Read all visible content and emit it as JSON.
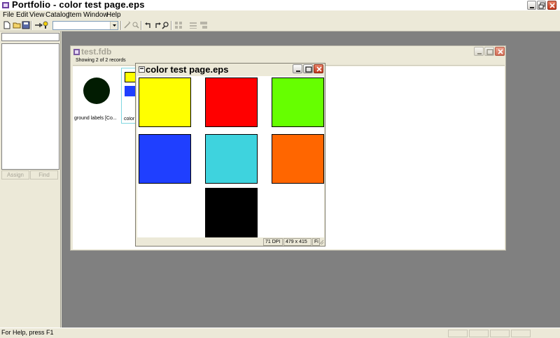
{
  "app": {
    "title": "Portfolio - color test page.eps"
  },
  "menu": [
    "File",
    "Edit",
    "View",
    "Catalog",
    "Item",
    "Window",
    "Help"
  ],
  "toolbar": {
    "combo_value": ""
  },
  "leftpane": {
    "assign_label": "Assign",
    "find_label": "Find"
  },
  "fdb_window": {
    "title": "test.fdb",
    "records_info": "Showing 2 of 2 records",
    "items": [
      {
        "label": "ground labels [Co..."
      },
      {
        "label": "color t"
      }
    ]
  },
  "eps_window": {
    "title": "color test page.eps",
    "swatches": [
      {
        "name": "yellow",
        "color": "#ffff00"
      },
      {
        "name": "red",
        "color": "#ff0000"
      },
      {
        "name": "green",
        "color": "#66ff00"
      },
      {
        "name": "blue",
        "color": "#1f3fff"
      },
      {
        "name": "cyan",
        "color": "#3ed3de"
      },
      {
        "name": "orange",
        "color": "#ff6600"
      },
      {
        "name": "black",
        "color": "#000000"
      }
    ],
    "dpi": "71 DPI",
    "size": "479 x 415",
    "extra": "Fi"
  },
  "statusbar": {
    "text": "For Help, press F1"
  }
}
